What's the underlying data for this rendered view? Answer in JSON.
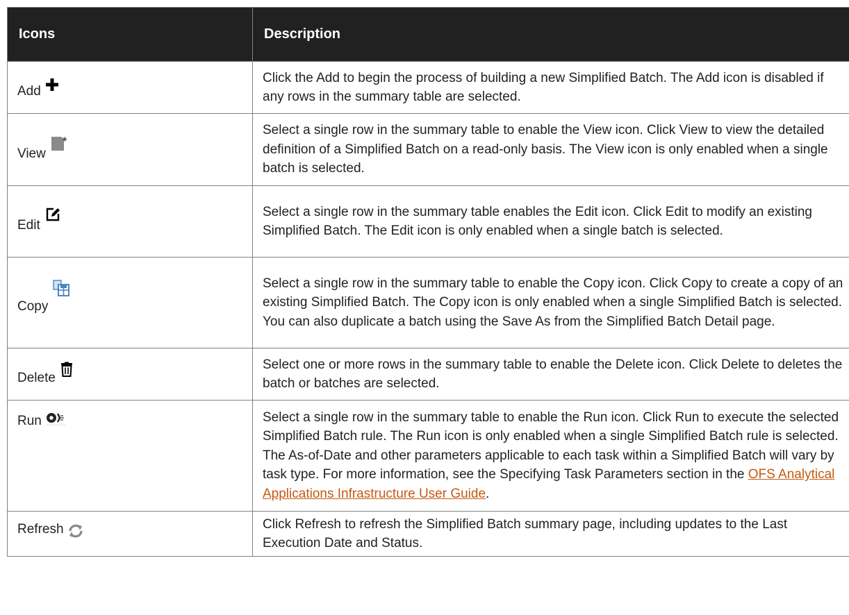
{
  "table": {
    "headers": [
      "Icons",
      "Description"
    ],
    "rows": [
      {
        "name": "Add",
        "icon": "plus-icon",
        "desc": "Click the Add to begin the process of building a new Simplified Batch. The Add icon is disabled if any rows in the summary table are selected."
      },
      {
        "name": "View",
        "icon": "view-page-icon",
        "desc": "Select a single row in the summary table to enable the View icon. Click View to view the detailed definition of a Simplified Batch on a read-only basis. The View icon is only enabled when a single batch is selected."
      },
      {
        "name": "Edit",
        "icon": "edit-pencil-icon",
        "desc": "Select a single row in the summary table enables the Edit icon. Click Edit to modify an existing Simplified Batch. The Edit icon is only enabled when a single batch is selected."
      },
      {
        "name": "Copy",
        "icon": "copy-icon",
        "desc": "Select a single row in the summary table to enable the Copy icon. Click Copy to create a copy of an existing Simplified Batch. The Copy icon is only enabled when a single Simplified Batch is selected. You can also duplicate a batch using the Save As from the Simplified Batch Detail page."
      },
      {
        "name": "Delete",
        "icon": "trash-icon",
        "desc": "Select one or more rows in the summary table to enable the Delete icon. Click Delete to deletes the batch or batches are selected."
      },
      {
        "name": "Run",
        "icon": "run-gear-icon",
        "desc": "Select a single row in the summary table to enable the Run icon. Click Run to execute the selected Simplified Batch rule. The Run icon is only enabled when a single Simplified Batch rule is selected. The As-of-Date and other parameters applicable to each task within a Simplified Batch will vary by task type. For more information, see the Specifying Task Parameters section in the ",
        "link": "OFS Analytical Applications Infrastructure User Guide",
        "desc_end": "."
      },
      {
        "name": "Refresh",
        "icon": "refresh-icon",
        "desc": "Click Refresh to refresh the Simplified Batch summary page, including updates to the Last Execution Date and Status."
      }
    ]
  },
  "colors": {
    "header_bg": "#212121",
    "header_text": "#ffffff",
    "link": "#c55a11",
    "border": "#7f7f7f"
  }
}
